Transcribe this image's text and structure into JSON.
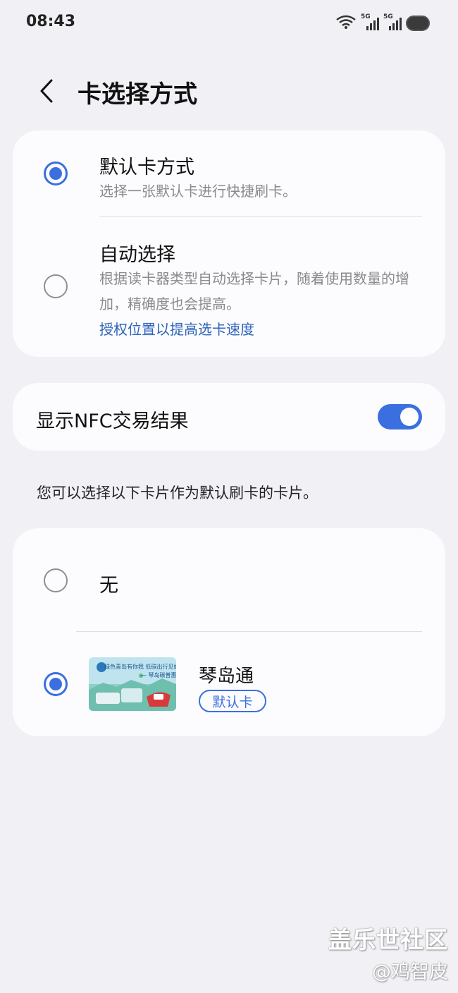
{
  "status_bar": {
    "time": "08:43",
    "network_1": "5G",
    "network_2": "5G"
  },
  "header": {
    "title": "卡选择方式"
  },
  "selection_mode": {
    "options": [
      {
        "title": "默认卡方式",
        "description": "选择一张默认卡进行快捷刷卡。",
        "selected": true
      },
      {
        "title": "自动选择",
        "description": "根据读卡器类型自动选择卡片，随着使用数量的增加，精确度也会提高。",
        "link": "授权位置以提高选卡速度",
        "selected": false
      }
    ]
  },
  "nfc_result": {
    "label": "显示NFC交易结果",
    "enabled": true
  },
  "card_list": {
    "caption": "您可以选择以下卡片作为默认刷卡的卡片。",
    "none_label": "无",
    "cards": [
      {
        "name": "琴岛通",
        "badge": "默认卡",
        "selected": true,
        "thumb_line1": "绿色青岛有你我 低碳出行见好礼",
        "thumb_line2": "— 琴岛碳普惠"
      }
    ]
  },
  "watermark": {
    "line1": "盖乐世社区",
    "line2": "@鸡智皮"
  },
  "colors": {
    "accent": "#3b6fe0",
    "link": "#2f64b9",
    "background": "#f1f0f5",
    "card": "#fcfcfe"
  }
}
